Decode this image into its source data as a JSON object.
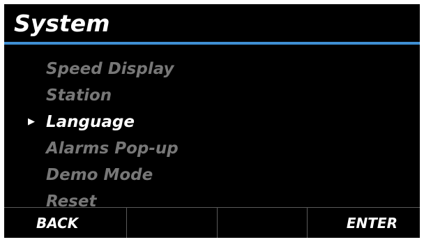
{
  "screen": {
    "title": "System",
    "colors": {
      "background": "#000000",
      "title_rule": "#3f8fd3",
      "item_selected": "#ffffff",
      "item_dim": "#777777"
    }
  },
  "menu": {
    "cursor_icon": "right-triangle-icon",
    "selected_index": 2,
    "items": [
      {
        "label": "Speed Display"
      },
      {
        "label": "Station"
      },
      {
        "label": "Language"
      },
      {
        "label": "Alarms Pop-up"
      },
      {
        "label": "Demo Mode"
      },
      {
        "label": "Reset"
      }
    ]
  },
  "softkeys": [
    {
      "label": "BACK"
    },
    {
      "label": ""
    },
    {
      "label": ""
    },
    {
      "label": "ENTER"
    }
  ]
}
